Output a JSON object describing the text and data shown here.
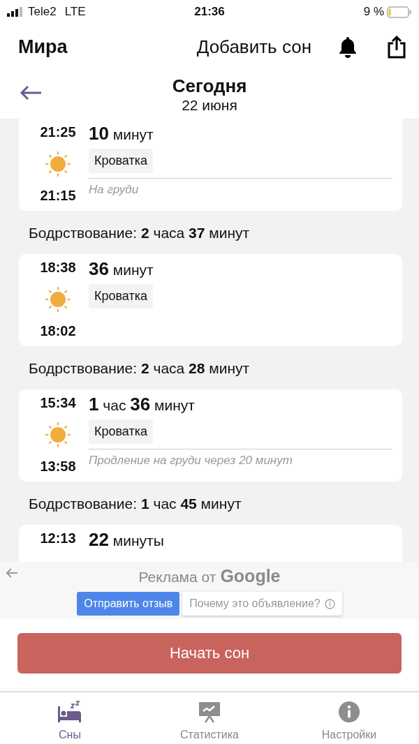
{
  "status_bar": {
    "carrier": "Tele2",
    "network": "LTE",
    "time": "21:36",
    "battery": "9 %"
  },
  "header": {
    "name": "Мира",
    "action": "Добавить сон"
  },
  "date_header": {
    "title": "Сегодня",
    "date": "22 июня"
  },
  "entries": [
    {
      "kind": "sleep",
      "end": "21:25",
      "start": "21:15",
      "duration": "**10** минут",
      "place": "Кроватка",
      "note": "На груди"
    },
    {
      "kind": "wake",
      "text": "Бодрствование: **2** часа **37** минут"
    },
    {
      "kind": "sleep",
      "end": "18:38",
      "start": "18:02",
      "duration": "**36** минут",
      "place": "Кроватка"
    },
    {
      "kind": "wake",
      "text": "Бодрствование: **2** часа **28** минут"
    },
    {
      "kind": "sleep",
      "end": "15:34",
      "start": "13:58",
      "duration": "**1** час **36** минут",
      "place": "Кроватка",
      "note": "Продление на груди через 20 минут"
    },
    {
      "kind": "wake",
      "text": "Бодрствование: **1** час **45** минут"
    },
    {
      "kind": "sleep",
      "end": "12:13",
      "duration": "**22** минуты"
    }
  ],
  "ad": {
    "label": "Реклама от",
    "brand": "Google",
    "feedback_button": "Отправить отзыв",
    "why_button": "Почему это объявление?"
  },
  "start_button": "Начать сон",
  "tabs": [
    {
      "label": "Сны",
      "selected": true
    },
    {
      "label": "Статистика",
      "selected": false
    },
    {
      "label": "Настройки",
      "selected": false
    }
  ]
}
